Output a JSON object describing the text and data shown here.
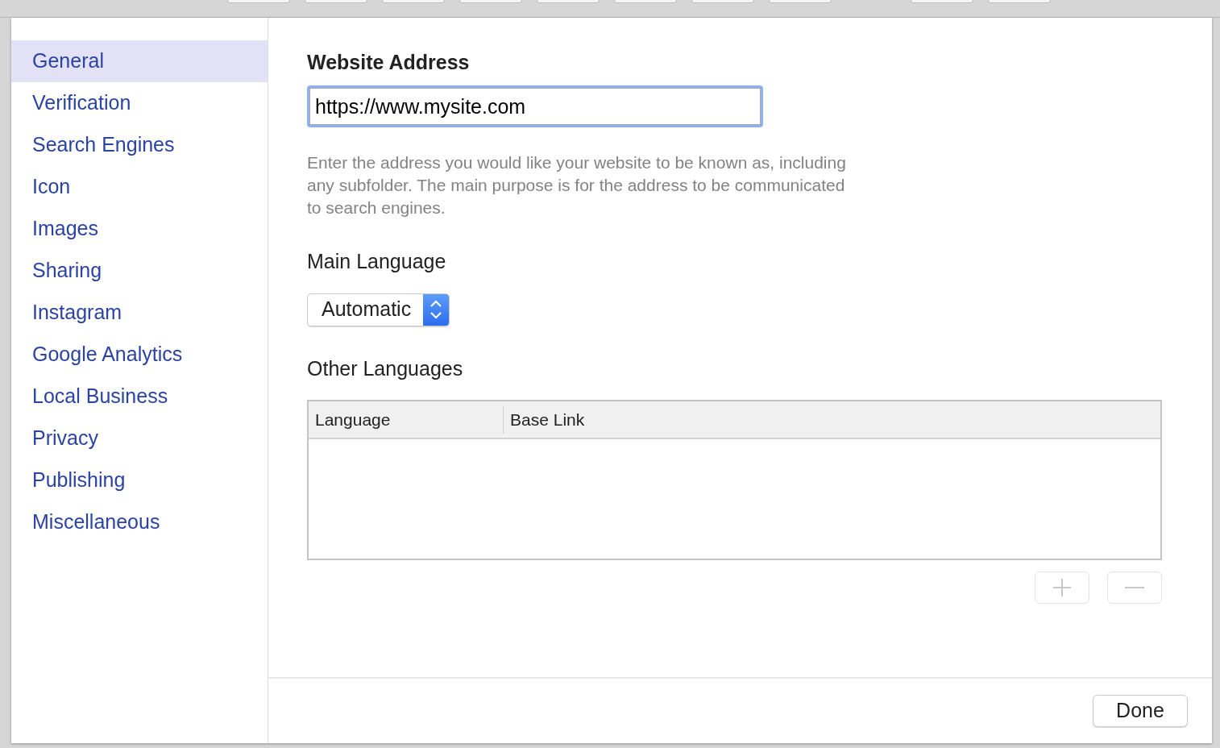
{
  "sidebar": {
    "items": [
      {
        "label": "General",
        "selected": true
      },
      {
        "label": "Verification",
        "selected": false
      },
      {
        "label": "Search Engines",
        "selected": false
      },
      {
        "label": "Icon",
        "selected": false
      },
      {
        "label": "Images",
        "selected": false
      },
      {
        "label": "Sharing",
        "selected": false
      },
      {
        "label": "Instagram",
        "selected": false
      },
      {
        "label": "Google Analytics",
        "selected": false
      },
      {
        "label": "Local Business",
        "selected": false
      },
      {
        "label": "Privacy",
        "selected": false
      },
      {
        "label": "Publishing",
        "selected": false
      },
      {
        "label": "Miscellaneous",
        "selected": false
      }
    ]
  },
  "website_address": {
    "heading": "Website Address",
    "value": "https://www.mysite.com",
    "focused": true,
    "help": "Enter the address you would like your website to be known as, including any subfolder. The main purpose is for the address to be communicated to search engines."
  },
  "main_language": {
    "heading": "Main Language",
    "value": "Automatic"
  },
  "other_languages": {
    "heading": "Other Languages",
    "columns": [
      "Language",
      "Base Link"
    ],
    "buttons": [
      {
        "kind": "add",
        "disabled": true
      },
      {
        "kind": "remove",
        "disabled": true
      }
    ]
  },
  "footer": {
    "done": "Done"
  }
}
